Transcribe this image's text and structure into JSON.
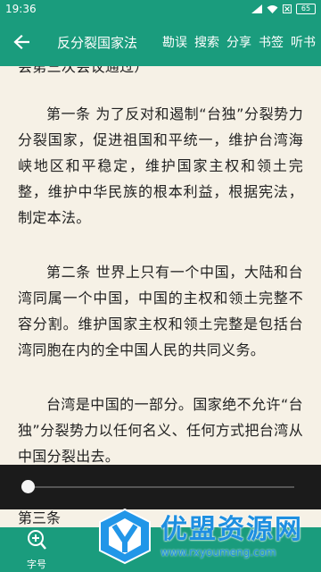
{
  "status": {
    "time": "19:36",
    "battery": "65"
  },
  "appbar": {
    "title": "反分裂国家法",
    "actions": [
      "勘误",
      "搜索",
      "分享",
      "书签",
      "听书"
    ]
  },
  "content": {
    "cut_line": "会第三次会议通过）",
    "paragraphs": [
      "第一条 为了反对和遏制“台独”分裂势力分裂国家，促进祖国和平统一，维护台湾海峡地区和平稳定，维护国家主权和领土完整，维护中华民族的根本利益，根据宪法，制定本法。",
      "第二条 世界上只有一个中国，大陆和台湾同属一个中国，中国的主权和领土完整不容分割。维护国家主权和领土完整是包括台湾同胞在内的全中国人民的共同义务。",
      "台湾是中国的一部分。国家绝不允许“台独”分裂势力以任何名义、任何方式把台湾从中国分裂出去。"
    ],
    "peek": "第三条"
  },
  "reading_progress": 0.0,
  "toolbar": {
    "font_label": "字号"
  },
  "watermark": {
    "title": "优盟资源网",
    "url": "www.rxyoumeng.com"
  },
  "colors": {
    "primary": "#1a9c7d",
    "slider_bg": "#1b1b1b",
    "page_bg": "#f6f1e6",
    "watermark": "#1e8fe0"
  }
}
